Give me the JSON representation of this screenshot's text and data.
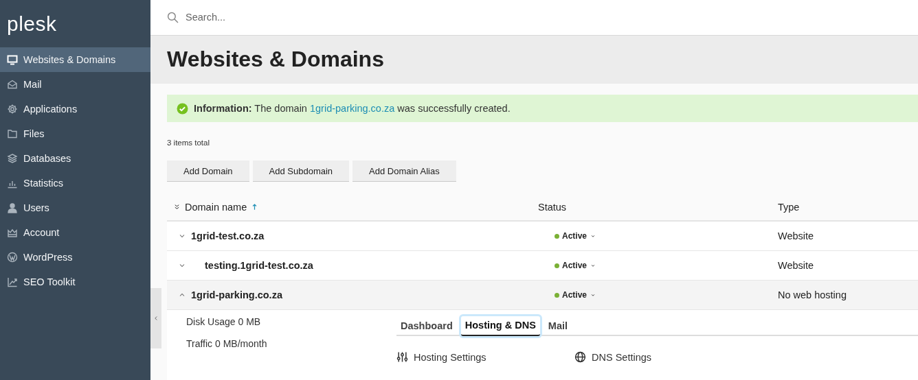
{
  "logo": "plesk",
  "nav": [
    {
      "label": "Websites & Domains",
      "selected": true
    },
    {
      "label": "Mail",
      "selected": false
    },
    {
      "label": "Applications",
      "selected": false
    },
    {
      "label": "Files",
      "selected": false
    },
    {
      "label": "Databases",
      "selected": false
    },
    {
      "label": "Statistics",
      "selected": false
    },
    {
      "label": "Users",
      "selected": false
    },
    {
      "label": "Account",
      "selected": false
    },
    {
      "label": "WordPress",
      "selected": false
    },
    {
      "label": "SEO Toolkit",
      "selected": false
    }
  ],
  "search": {
    "placeholder": "Search..."
  },
  "page_title": "Websites & Domains",
  "message": {
    "lead": "**Information:** The domain",
    "link": "1grid-parking.co.za",
    "tail": "was successfully created."
  },
  "items_total": "3 items total",
  "buttons": [
    "Add Domain",
    "Add Subdomain",
    "Add Domain Alias"
  ],
  "table": {
    "columns": [
      "Domain name",
      "Status",
      "Type"
    ],
    "rows": [
      {
        "name": "1grid-test.co.za",
        "status": "Active",
        "type": "Website",
        "expanded": false,
        "children": [
          {
            "name": "testing.1grid-test.co.za",
            "status": "Active",
            "type": "Website",
            "expanded": false
          }
        ]
      },
      {
        "name": "1grid-parking.co.za",
        "status": "Active",
        "type": "No web hosting",
        "expanded": true,
        "details": {
          "stats": [
            {
              "label": "Disk Usage",
              "value": "0 MB"
            },
            {
              "label": "Traffic",
              "value": "0 MB/month"
            }
          ],
          "tabs": [
            {
              "label": "Dashboard",
              "selected": false
            },
            {
              "label": "Hosting & DNS",
              "selected": true
            },
            {
              "label": "Mail",
              "selected": false
            }
          ],
          "actions": [
            "Hosting Settings",
            "DNS Settings"
          ]
        }
      }
    ]
  }
}
